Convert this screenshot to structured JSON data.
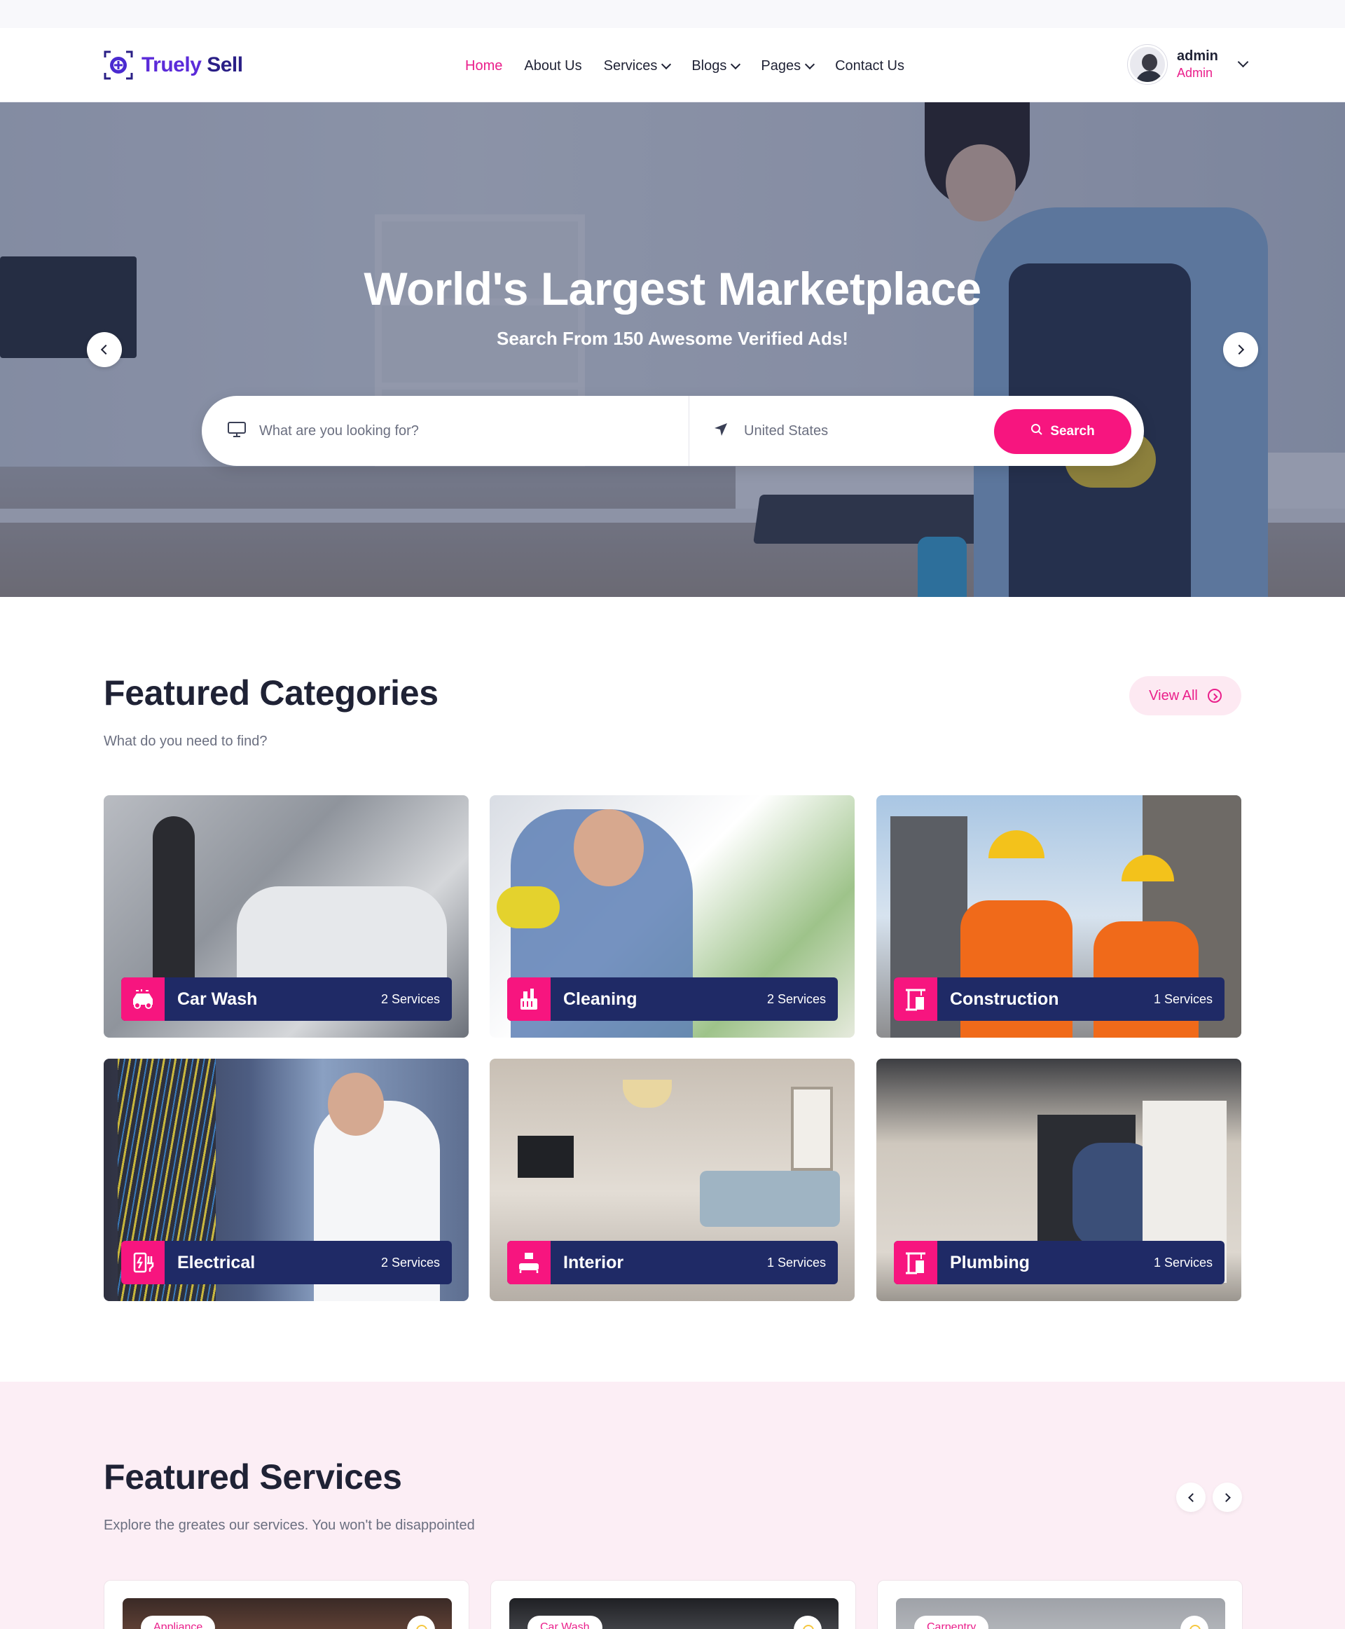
{
  "brand": {
    "name_part1": "Truely",
    "name_part2": "Sell"
  },
  "nav": [
    {
      "label": "Home",
      "active": true,
      "dropdown": false
    },
    {
      "label": "About Us",
      "active": false,
      "dropdown": false
    },
    {
      "label": "Services",
      "active": false,
      "dropdown": true
    },
    {
      "label": "Blogs",
      "active": false,
      "dropdown": true
    },
    {
      "label": "Pages",
      "active": false,
      "dropdown": true
    },
    {
      "label": "Contact Us",
      "active": false,
      "dropdown": false
    }
  ],
  "user": {
    "name": "admin",
    "role": "Admin"
  },
  "hero": {
    "title": "World's Largest Marketplace",
    "subtitle": "Search From 150 Awesome Verified Ads!",
    "search_placeholder": "What are you looking for?",
    "location": "United States",
    "search_button": "Search"
  },
  "categories_section": {
    "title": "Featured Categories",
    "subtitle": "What do you need to find?",
    "view_all": "View All",
    "items": [
      {
        "name": "Car Wash",
        "count": "2 Services",
        "icon": "car-wash-icon"
      },
      {
        "name": "Cleaning",
        "count": "2 Services",
        "icon": "cleaning-icon"
      },
      {
        "name": "Construction",
        "count": "1 Services",
        "icon": "construction-icon"
      },
      {
        "name": "Electrical",
        "count": "2 Services",
        "icon": "electrical-icon"
      },
      {
        "name": "Interior",
        "count": "1 Services",
        "icon": "interior-icon"
      },
      {
        "name": "Plumbing",
        "count": "1 Services",
        "icon": "plumbing-icon"
      }
    ]
  },
  "services_section": {
    "title": "Featured Services",
    "subtitle": "Explore the greates our services. You won't be disappointed",
    "cards": [
      {
        "tag": "Appliance"
      },
      {
        "tag": "Car Wash"
      },
      {
        "tag": "Carpentry"
      }
    ]
  },
  "colors": {
    "accent": "#f7157f",
    "navy": "#1f2a66",
    "brand": "#5b2bd9",
    "services_bg": "#fceef5"
  }
}
